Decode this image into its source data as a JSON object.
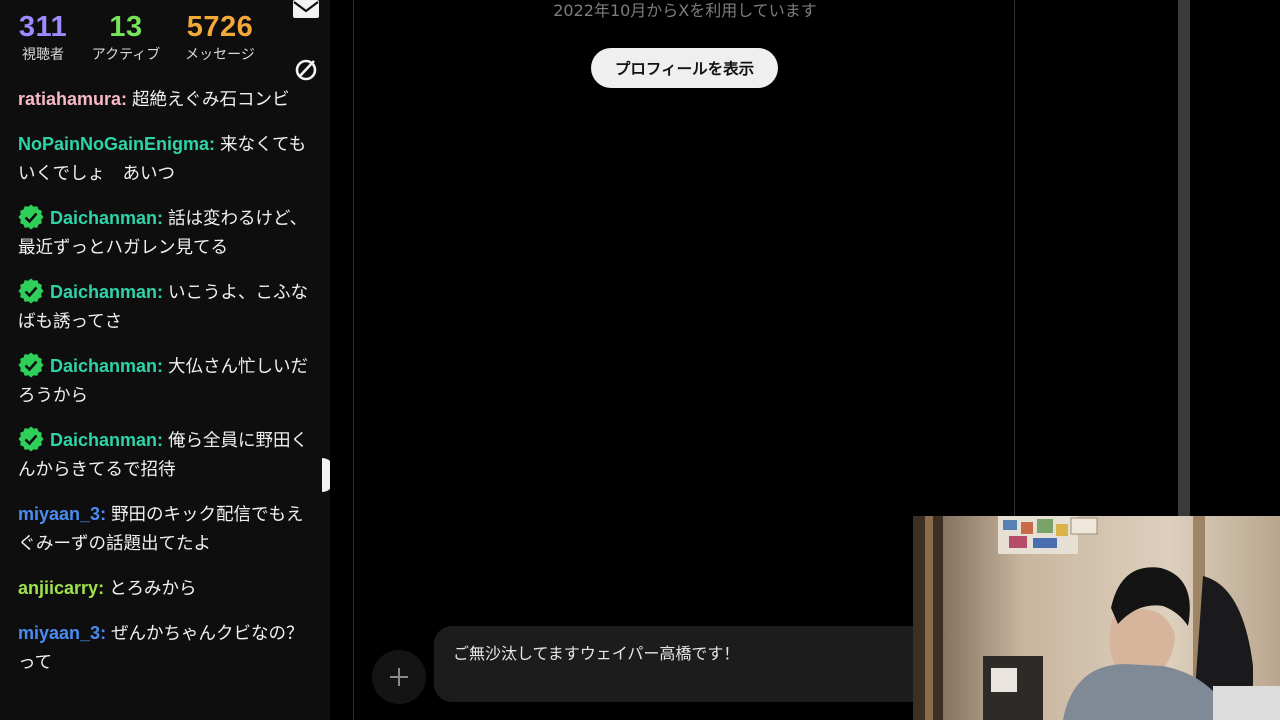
{
  "stats": {
    "viewers": {
      "value": "311",
      "label": "視聴者"
    },
    "active": {
      "value": "13",
      "label": "アクティブ"
    },
    "messages": {
      "value": "5726",
      "label": "メッセージ"
    }
  },
  "icons": {
    "mail": "mail-icon",
    "filter": "no-sign-icon",
    "badge": "verified-badge-icon",
    "add": "plus-icon"
  },
  "chat": {
    "messages": [
      {
        "user": "ratiahamura",
        "color": "#f7b8c8",
        "verified": false,
        "text": "超絶えぐみ石コンビ"
      },
      {
        "user": "NoPainNoGainEnigma",
        "color": "#2ed3a6",
        "verified": false,
        "text": "来なくてもいくでしょ　あいつ"
      },
      {
        "user": "Daichanman",
        "color": "#2ed3a6",
        "verified": true,
        "text": "話は変わるけど、最近ずっとハガレン見てる"
      },
      {
        "user": "Daichanman",
        "color": "#2ed3a6",
        "verified": true,
        "text": "いこうよ、こふなばも誘ってさ"
      },
      {
        "user": "Daichanman",
        "color": "#2ed3a6",
        "verified": true,
        "text": "大仏さん忙しいだろうから"
      },
      {
        "user": "Daichanman",
        "color": "#2ed3a6",
        "verified": true,
        "text": "俺ら全員に野田くんからきてるで招待"
      },
      {
        "user": "miyaan_3",
        "color": "#4a8cf0",
        "verified": false,
        "text": "野田のキック配信でもえぐみーずの話題出てたよ"
      },
      {
        "user": "anjiicarry",
        "color": "#9fe24a",
        "verified": false,
        "text": "とろみから"
      },
      {
        "user": "miyaan_3",
        "color": "#4a8cf0",
        "verified": false,
        "text": "ぜんかちゃんクビなの？って"
      }
    ]
  },
  "profile": {
    "joined_text": "2022年10月からXを利用しています",
    "view_profile_label": "プロフィールを表示"
  },
  "composer": {
    "message_text": "ご無沙汰してますウェイパー高橋です！"
  },
  "colors": {
    "verified_badge": "#2fd05a"
  }
}
